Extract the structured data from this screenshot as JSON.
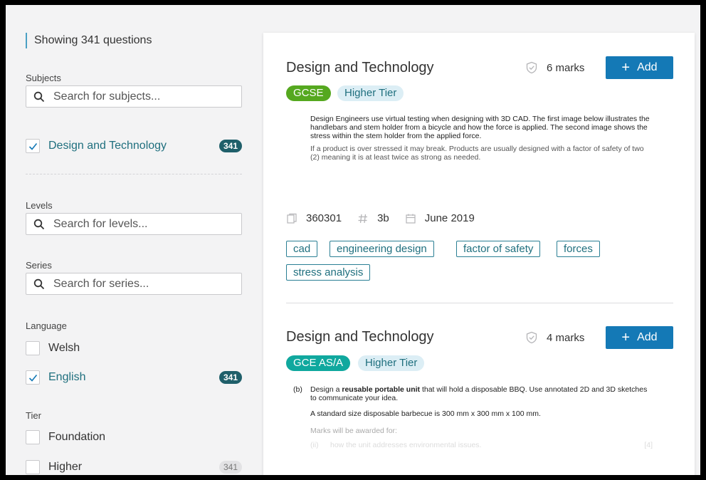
{
  "sidebar": {
    "showing": "Showing 341 questions",
    "subjects": {
      "label": "Subjects",
      "placeholder": "Search for subjects...",
      "items": [
        {
          "label": "Design and Technology",
          "count": "341",
          "checked": true
        }
      ]
    },
    "levels": {
      "label": "Levels",
      "placeholder": "Search for levels..."
    },
    "series": {
      "label": "Series",
      "placeholder": "Search for series..."
    },
    "language": {
      "label": "Language",
      "items": [
        {
          "label": "Welsh",
          "checked": false
        },
        {
          "label": "English",
          "count": "341",
          "checked": true
        }
      ]
    },
    "tier": {
      "label": "Tier",
      "items": [
        {
          "label": "Foundation",
          "checked": false
        },
        {
          "label": "Higher",
          "count": "341",
          "checked": false
        }
      ]
    }
  },
  "questions": [
    {
      "title": "Design and Technology",
      "marks": "6 marks",
      "add_label": "Add",
      "level": "GCSE",
      "tier": "Higher Tier",
      "excerpt": [
        "Design Engineers use virtual testing when designing with 3D CAD. The first image below illustrates the handlebars and stem holder from a bicycle and how the force is applied. The second image shows the stress within the stem holder from the applied force.",
        "If a product is over stressed it may break. Products are usually designed with a factor of safety of two (2) meaning it is at least twice as strong as needed."
      ],
      "meta": {
        "id": "360301",
        "number": "3b",
        "date": "June 2019"
      },
      "tags": [
        "cad",
        "engineering design",
        "factor of safety",
        "forces",
        "stress analysis"
      ]
    },
    {
      "title": "Design and Technology",
      "marks": "4 marks",
      "add_label": "Add",
      "level": "GCE AS/A",
      "tier": "Higher Tier",
      "excerpt": {
        "label": "(b)",
        "line1_pre": "Design a ",
        "line1_bold": "reusable portable unit",
        "line1_post": " that will hold a disposable BBQ. Use annotated 2D and 3D sketches to communicate your idea.",
        "line2": "A standard size disposable barbecue is 300 mm x 300 mm x 100 mm.",
        "line3": "Marks will be awarded for:",
        "line4_label": "(ii)",
        "line4": "how the unit addresses environmental issues.",
        "line4_marks": "[4]"
      }
    }
  ],
  "colors": {
    "accent": "#1479b6",
    "gcse": "#55a81f",
    "gceas": "#10a89e",
    "tier_bg": "#dceef5",
    "badge_dark": "#1f5f6a"
  }
}
